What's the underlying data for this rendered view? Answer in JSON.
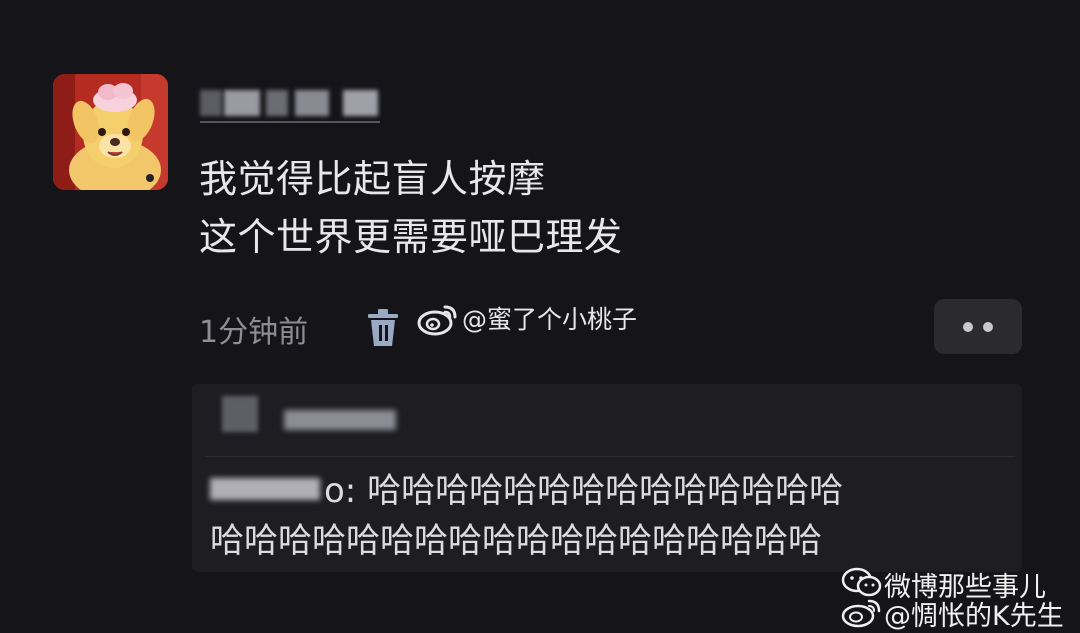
{
  "comment": {
    "text_line1": "我觉得比起盲人按摩",
    "text_line2": "这个世界更需要哑巴理发",
    "time": "1分钟前",
    "watermark_handle": "@蜜了个小桃子"
  },
  "reply": {
    "line1_suffix": "o: 哈哈哈哈哈哈哈哈哈哈哈哈哈哈",
    "line2": "哈哈哈哈哈哈哈哈哈哈哈哈哈哈哈哈哈哈"
  },
  "watermark": {
    "line1": "微博那些事儿",
    "line2": "@惆怅的K先生"
  },
  "icons": {
    "avatar": "cartoon-character-avatar",
    "delete": "trash-icon",
    "more": "more-dots-icon",
    "weibo": "weibo-logo-icon",
    "wechat": "wechat-logo-icon"
  },
  "colors": {
    "background": "#151418",
    "reply_box": "#1e1d22",
    "button": "#2b2a2f",
    "text": "#e8e8ea",
    "muted": "#8d8d93",
    "trash_blue": "#9aa8c4"
  }
}
